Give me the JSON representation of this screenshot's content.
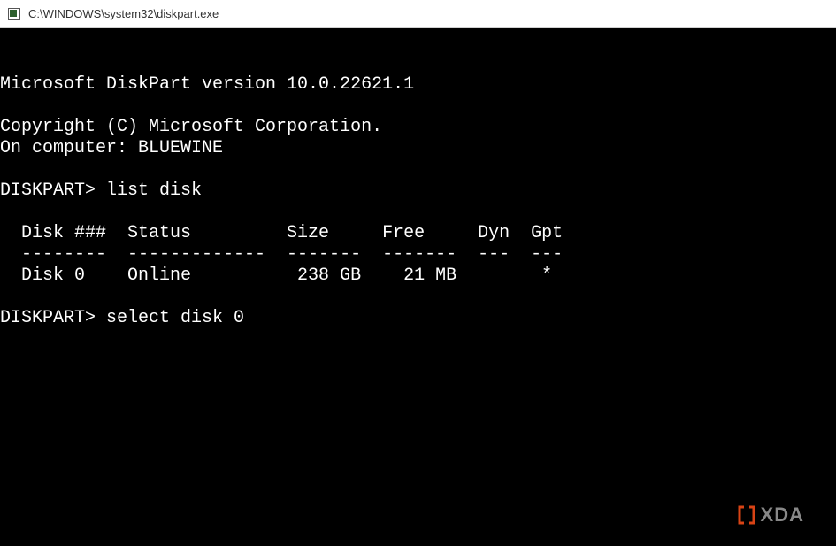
{
  "window": {
    "title": "C:\\WINDOWS\\system32\\diskpart.exe"
  },
  "terminal": {
    "version_line": "Microsoft DiskPart version 10.0.22621.1",
    "copyright_line": "Copyright (C) Microsoft Corporation.",
    "computer_line": "On computer: BLUEWINE",
    "prompt1": "DISKPART> ",
    "command1": "list disk",
    "table": {
      "header": "  Disk ###  Status         Size     Free     Dyn  Gpt",
      "divider": "  --------  -------------  -------  -------  ---  ---",
      "row1": "  Disk 0    Online          238 GB    21 MB        *"
    },
    "prompt2": "DISKPART> ",
    "command2": "select disk 0"
  },
  "watermark": {
    "text": "XDA"
  }
}
